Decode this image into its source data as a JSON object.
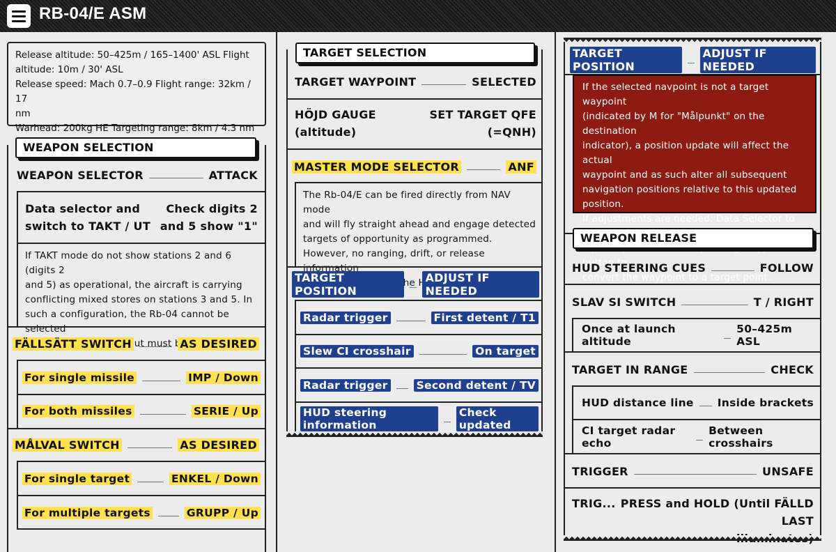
{
  "app": {
    "title": "RB-04/E ASM"
  },
  "specs": {
    "line1": "Release altitude: 50–425m / 165–1400' ASL Flight",
    "line2": "altitude: 10m / 30' ASL",
    "line3": "Release speed: Mach 0.7–0.9 Flight range: 32km / 17",
    "line4": "nm",
    "line5": "Warhead: 200kg HE Targeting range: 8km / 4.3 nm"
  },
  "weapon_selection": {
    "title": "WEAPON SELECTION",
    "selector": {
      "label": "WEAPON SELECTOR",
      "value": "ATTACK"
    },
    "data_selector": {
      "label_l1": "Data selector and",
      "label_l2": "switch to TAKT / UT",
      "value_l1": "Check digits 2",
      "value_l2": "and 5 show \"1\""
    },
    "note": [
      "If TAKT mode do not show stations 2 and 6 (digits 2",
      "and 5) as operational, the aircraft is carrying",
      "conflicting mixed stores on stations 3 and 5. In",
      "such a configuration, the Rb-04 cannot be selected",
      "or used, and the loadout must be altered."
    ],
    "fallsatt": {
      "label": "FÄLLSÄTT SWITCH",
      "value": "AS DESIRED"
    },
    "single_missile": {
      "label": "For single missile",
      "value": "IMP / Down"
    },
    "both_missiles": {
      "label": "For both missiles",
      "value": "SERIE / Up"
    },
    "malval": {
      "label": "MÅLVAL SWITCH",
      "value": "AS DESIRED"
    },
    "single_target": {
      "label": "For single target",
      "value": "ENKEL / Down"
    },
    "multiple_targets": {
      "label": "For multiple targets",
      "value": "GRUPP / Up"
    }
  },
  "target_selection": {
    "title": "TARGET SELECTION",
    "waypoint": {
      "label": "TARGET WAYPOINT",
      "value": "SELECTED"
    },
    "hojd": {
      "label_l1": "HÖJD GAUGE",
      "label_l2": "(altitude)",
      "value_l1": "SET TARGET QFE",
      "value_l2": "(=QNH)"
    },
    "master_mode": {
      "label": "MASTER MODE SELECTOR",
      "value": "ANF"
    },
    "note": [
      "The Rb-04/E can be fired directly from NAV mode",
      "and will fly straight ahead and engage detected",
      "targets of opportunity as programmed.",
      "However, no ranging, drift, or release information",
      "will be available on the HUD."
    ],
    "position": {
      "label": "TARGET POSITION",
      "value": "ADJUST IF NEEDED"
    },
    "radar1": {
      "label": "Radar trigger",
      "value": "First detent / T1"
    },
    "slew": {
      "label": "Slew CI crosshair",
      "value": "On target"
    },
    "radar2": {
      "label": "Radar trigger",
      "value": "Second detent / TV"
    },
    "hud_info": {
      "label": "HUD steering information",
      "value": "Check updated"
    }
  },
  "col3": {
    "position": {
      "label": "TARGET POSITION",
      "value": "ADJUST IF NEEDED"
    },
    "warning": [
      "If the selected navpoint is not a target waypoint",
      "(indicated by M for \"Målpunkt\" on the destination",
      "indicator), a position update will affect the actual",
      "waypoint and as such alter all subsequent",
      "navigation positions relative to this updated",
      "position.",
      "If adjustments are needed: Data Selector to TAKT,",
      "input 9, press the corresponding waypoint button to",
      "convert the waypoint to a target point."
    ],
    "release_title": "WEAPON RELEASE",
    "hud_cues": {
      "label": "HUD STEERING CUES",
      "value": "FOLLOW"
    },
    "slav": {
      "label": "SLAV SI SWITCH",
      "value": "T / RIGHT"
    },
    "launch_alt": {
      "label": "Once at launch altitude",
      "value": "50–425m ASL"
    },
    "in_range": {
      "label": "TARGET IN RANGE",
      "value": "CHECK"
    },
    "hud_dist": {
      "label": "HUD distance line",
      "value": "Inside brackets"
    },
    "ci_echo": {
      "label": "CI target radar echo",
      "value": "Between crosshairs"
    },
    "trigger": {
      "label": "TRIGGER",
      "value": "UNSAFE"
    },
    "trig": {
      "label": "TRIG...",
      "value_l1": "PRESS and HOLD (Until FÄLLD LAST",
      "value_l2": "illuminates)"
    }
  }
}
